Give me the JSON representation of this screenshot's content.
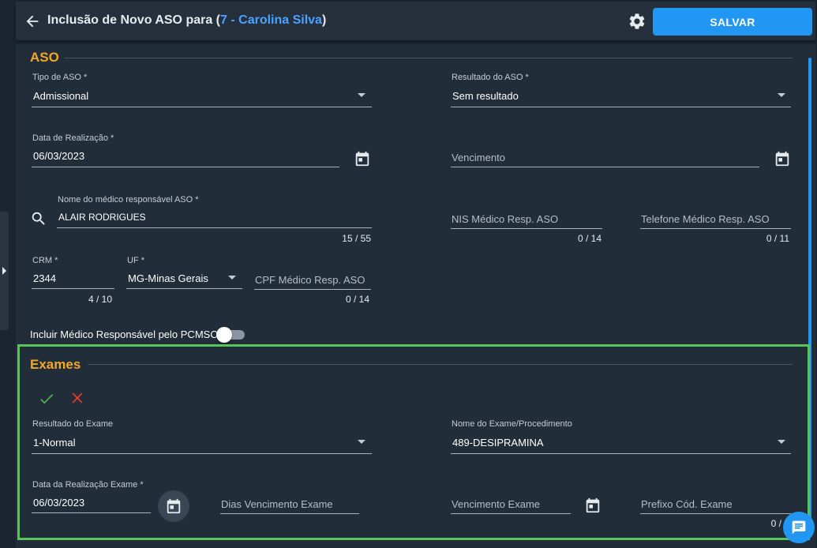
{
  "header": {
    "title_prefix": "Inclusão de Novo ASO para (",
    "title_highlight": "7 - Carolina Silva",
    "title_suffix": ")",
    "save_label": "SALVAR"
  },
  "aso": {
    "section_title": "ASO",
    "tipo_aso": {
      "label": "Tipo de ASO *",
      "value": "Admissional"
    },
    "resultado_aso": {
      "label": "Resultado do ASO *",
      "value": "Sem resultado"
    },
    "data_realizacao": {
      "label": "Data de Realização *",
      "value": "06/03/2023"
    },
    "vencimento": {
      "placeholder": "Vencimento"
    },
    "nome_medico": {
      "label": "Nome do médico responsável ASO *",
      "value": "ALAIR RODRIGUES",
      "counter": "15 / 55"
    },
    "nis_medico": {
      "placeholder": "NIS Médico Resp. ASO",
      "counter": "0 / 14"
    },
    "telefone_medico": {
      "placeholder": "Telefone Médico Resp. ASO",
      "counter": "0 / 11"
    },
    "crm": {
      "label": "CRM *",
      "value": "2344",
      "counter": "4 / 10"
    },
    "uf": {
      "label": "UF *",
      "value": "MG-Minas Gerais"
    },
    "cpf_medico": {
      "placeholder": "CPF Médico Resp. ASO",
      "counter": "0 / 14"
    },
    "incluir_pcmso": {
      "label": "Incluir Médico Responsável pelo PCMSO",
      "checked": false
    }
  },
  "exames": {
    "section_title": "Exames",
    "resultado_exame": {
      "label": "Resultado do Exame",
      "value": "1-Normal"
    },
    "nome_exame": {
      "label": "Nome do Exame/Procedimento",
      "value": "489-DESIPRAMINA"
    },
    "data_realizacao_exame": {
      "label": "Data da Realização Exame *",
      "value": "06/03/2023"
    },
    "dias_vencimento": {
      "placeholder": "Dias Vencimento Exame"
    },
    "vencimento_exame": {
      "placeholder": "Vencimento Exame"
    },
    "prefixo_cod": {
      "placeholder": "Prefixo Cód. Exame",
      "counter": "0 /"
    }
  },
  "colors": {
    "accent": "#2196f3",
    "section_title": "#f5a623",
    "highlight_border": "#58c45a",
    "confirm": "#4caf50",
    "cancel": "#e53935"
  },
  "icons": [
    "arrow-left-icon",
    "gear-icon",
    "calendar-icon",
    "search-icon",
    "check-icon",
    "close-icon",
    "chat-icon",
    "chevron-down-icon"
  ]
}
